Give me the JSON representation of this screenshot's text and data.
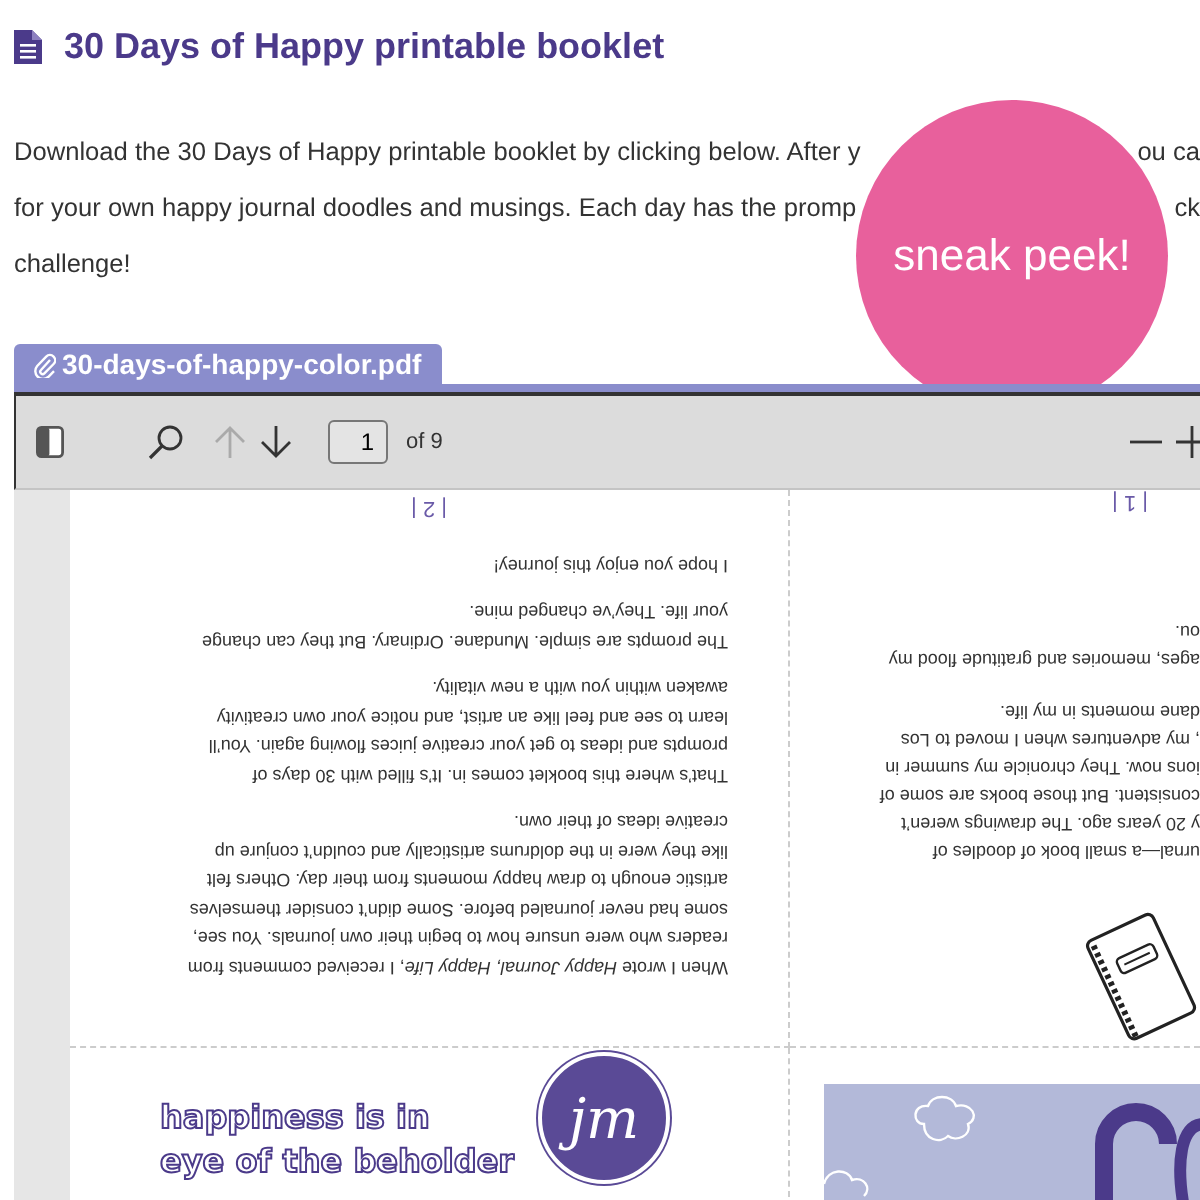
{
  "heading": {
    "title": "30 Days of Happy printable booklet"
  },
  "intro": {
    "lines": [
      {
        "left": "Download the 30 Days of Happy printable booklet by clicking below. After y",
        "right": "ou ca"
      },
      {
        "left": "for your own happy journal doodles and musings. Each day has the promp",
        "right": "ck"
      },
      {
        "left": "challenge!"
      }
    ]
  },
  "badge": {
    "text": "sneak peek!"
  },
  "attachment": {
    "filename": "30-days-of-happy-color.pdf"
  },
  "viewer": {
    "toolbar": {
      "prev": {
        "disabled": true
      },
      "next": {
        "disabled": false
      },
      "page": "1",
      "page_count": "of 9"
    },
    "page_left": {
      "paragraphs": [
        "When I wrote *Happy Journal, Happy Life*, I received comments from\nreaders who were unsure how to begin their own journals. You see,\nsome had never journaled before. Some didn’t consider themselves\nartistic enough to draw happy moments from their day. Others felt\nlike they were in the doldrums artistically and couldn’t conjure up\ncreative ideas of their own.",
        "That’s where this booklet comes in. It’s filled with 30 days of\nprompts and ideas to get your creative juices flowing again. You’ll\nlearn to see and feel like an artist, and notice your own creativity\nawaken within you with a new vitality.",
        "The prompts are simple. Mundane. Ordinary. But they can change\nyour life. They’ve changed mine.",
        "I hope you enjoy this journey!"
      ],
      "page_number": "| 2 |"
    },
    "page_right": {
      "paragraphs": [
        "urnal—a small book of doodles of\ny 20 years ago. The drawings weren’t\nconsistent. But those books are some of\nions now. They chronicle my summer in\n, my adventures when I moved to Los\ndane moments in my life.",
        "ages, memories and gratitude flood my\nou."
      ],
      "page_number": "| 1 |"
    },
    "cover": {
      "title_lines": [
        "happiness is in",
        "eye of the beholder"
      ],
      "logo": "jm"
    }
  }
}
